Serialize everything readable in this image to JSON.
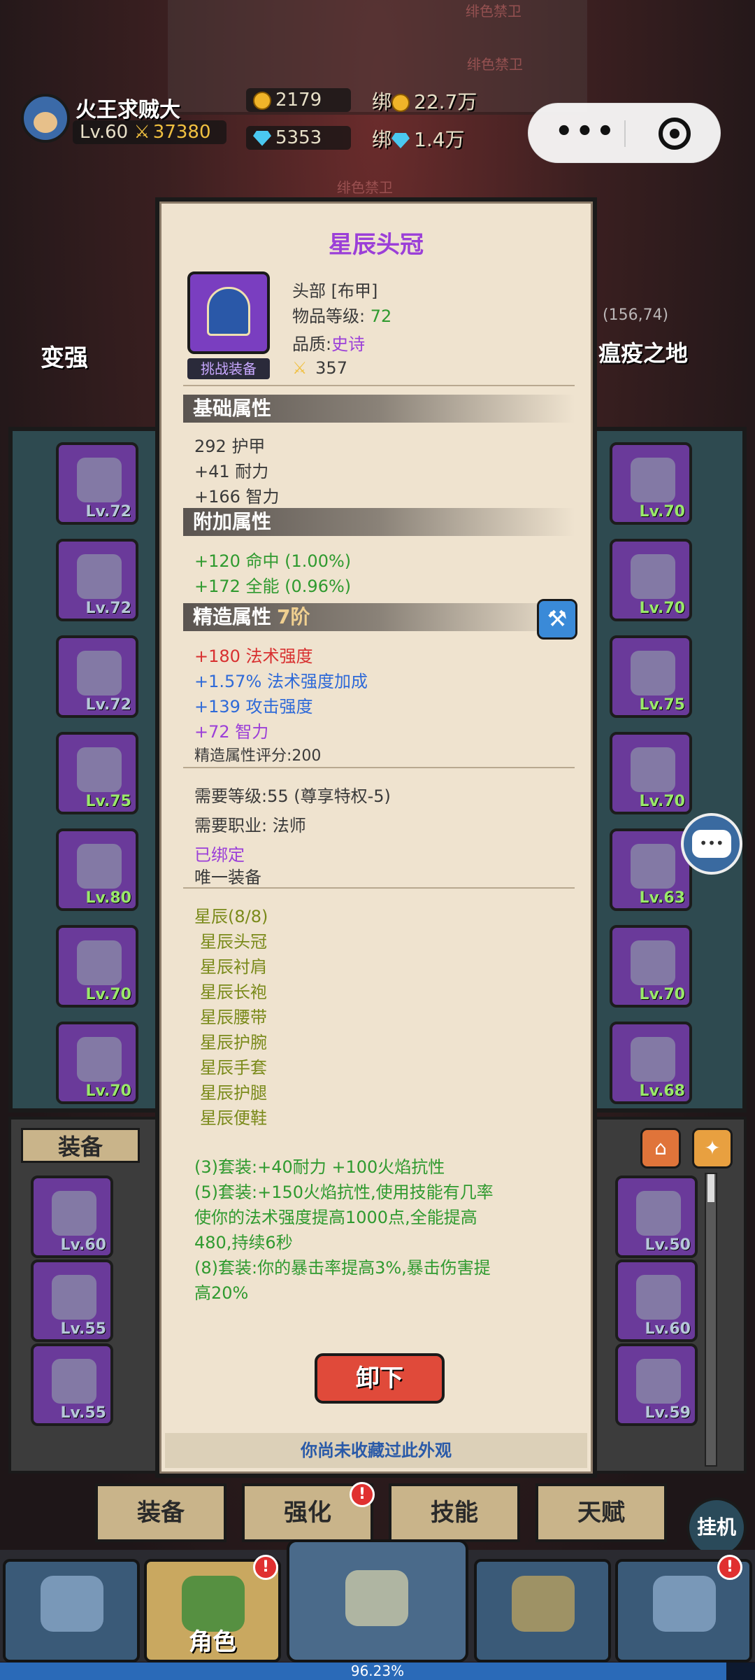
{
  "hud": {
    "player_name": "火王求贼大",
    "level": "Lv.60",
    "power": "37380",
    "gold": "2179",
    "diamonds": "5353",
    "bound_label_1": "绑",
    "bound_gold": "22.7万",
    "bound_label_2": "绑",
    "bound_diamonds": "1.4万"
  },
  "background": {
    "banner_1": "绯色禁卫",
    "banner_2": "绯色禁卫",
    "banner_3": "绯色禁卫",
    "strengthen_label": "变强",
    "zone_label": "瘟疫之地",
    "zone_coord": "(156,74)"
  },
  "slots_left": [
    "Lv.72",
    "Lv.72",
    "Lv.72",
    "Lv.75",
    "Lv.80",
    "Lv.70",
    "Lv.70"
  ],
  "slots_right": [
    "Lv.70",
    "Lv.70",
    "Lv.75",
    "Lv.70",
    "Lv.63",
    "Lv.70",
    "Lv.68"
  ],
  "bag": {
    "tab_label": "装备",
    "items_left": [
      "Lv.60",
      "Lv.55",
      "Lv.55"
    ],
    "items_right": [
      "Lv.50",
      "Lv.60",
      "Lv.59"
    ]
  },
  "subtabs": [
    "装备",
    "强化",
    "技能",
    "天赋"
  ],
  "hang_label": "挂机",
  "nav": {
    "role_label": "角色"
  },
  "progress": {
    "percent": 96.23,
    "text": "96.23%"
  },
  "item": {
    "name": "星辰头冠",
    "slot_type": "头部 [布甲]",
    "item_level_label": "物品等级:",
    "item_level": "72",
    "quality_label": "品质:",
    "quality": "史诗",
    "power": "357",
    "challenge_tag": "挑战装备",
    "base_header": "基础属性",
    "base_stats": [
      "292 护甲",
      "+41 耐力",
      "+166 智力"
    ],
    "extra_header": "附加属性",
    "extra_stats": [
      "+120 命中 (1.00%)",
      "+172 全能 (0.96%)"
    ],
    "forge_header": "精造属性",
    "forge_tier": "7阶",
    "forge_stats": [
      "+180 法术强度",
      "+1.57% 法术强度加成",
      "+139 攻击强度",
      "+72 智力"
    ],
    "forge_score": "精造属性评分:200",
    "req_level": "需要等级:55 (尊享特权-5)",
    "req_class": "需要职业: 法师",
    "bound": "已绑定",
    "unique": "唯一装备",
    "set_name": "星辰(8/8)",
    "set_pieces": [
      "星辰头冠",
      "星辰衬肩",
      "星辰长袍",
      "星辰腰带",
      "星辰护腕",
      "星辰手套",
      "星辰护腿",
      "星辰便鞋"
    ],
    "set_bonus": [
      "(3)套装:+40耐力 +100火焰抗性",
      "(5)套装:+150火焰抗性,使用技能有几率",
      "使你的法术强度提高1000点,全能提高",
      "480,持续6秒",
      "(8)套装:你的暴击率提高3%,暴击伤害提",
      "高20%"
    ],
    "unequip_label": "卸下",
    "footer_note": "你尚未收藏过此外观"
  },
  "colors": {
    "title_purple": "#9b3fd8",
    "stat_green": "#2f9a2f",
    "stat_red": "#d83030",
    "stat_blue": "#2f6ad8",
    "button_red": "#e04a3a"
  },
  "icons": [
    "coin-icon",
    "diamond-icon",
    "sword-icon",
    "helmet-icon",
    "hammer-icon",
    "chat-icon",
    "menu-dots-icon",
    "close-target-icon"
  ]
}
